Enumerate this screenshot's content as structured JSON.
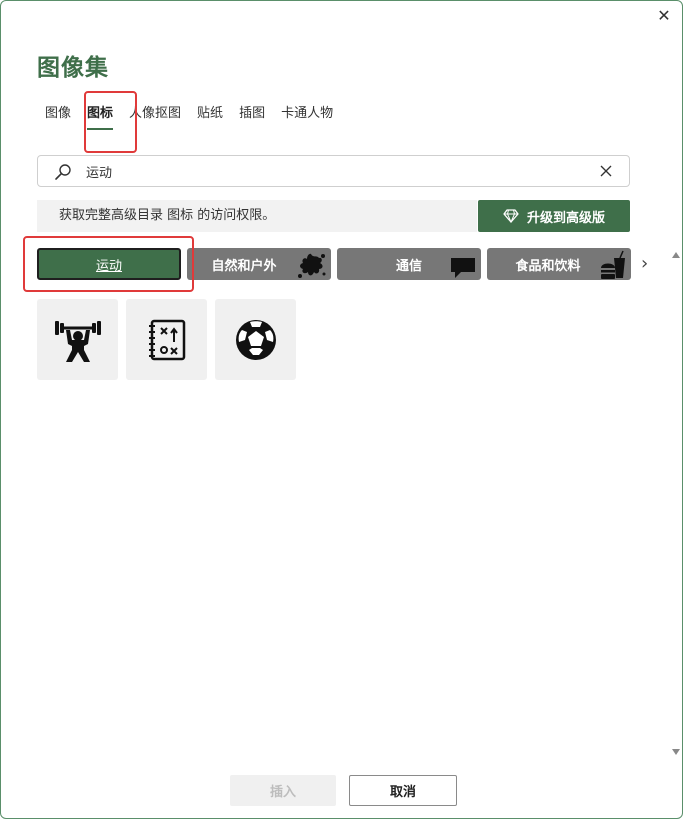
{
  "dialog": {
    "title": "图像集",
    "close_glyph": "✕"
  },
  "tabs": [
    {
      "label": "图像",
      "active": false
    },
    {
      "label": "图标",
      "active": true
    },
    {
      "label": "人像抠图",
      "active": false
    },
    {
      "label": "贴纸",
      "active": false
    },
    {
      "label": "插图",
      "active": false
    },
    {
      "label": "卡通人物",
      "active": false
    }
  ],
  "search": {
    "value": "运动",
    "icon": "search-icon",
    "clear_icon": "close-icon"
  },
  "notice": {
    "text": "获取完整高级目录 图标 的访问权限。"
  },
  "upgrade": {
    "label": "升级到高级版",
    "icon": "diamond-icon"
  },
  "categories": [
    {
      "label": "运动",
      "active": true
    },
    {
      "label": "自然和户外",
      "active": false,
      "icon": "splash-icon"
    },
    {
      "label": "通信",
      "active": false,
      "icon": "speech-bubble-icon"
    },
    {
      "label": "食品和饮料",
      "active": false,
      "icon": "burger-drink-icon"
    }
  ],
  "category_next_glyph": "›",
  "results": [
    {
      "icon": "weightlifter-icon"
    },
    {
      "icon": "playbook-icon"
    },
    {
      "icon": "soccer-ball-icon"
    }
  ],
  "footer": {
    "insert_label": "插入",
    "cancel_label": "取消"
  },
  "colors": {
    "accent": "#3f6f4a",
    "category_bg": "#777777",
    "highlight": "#e03a3a"
  }
}
